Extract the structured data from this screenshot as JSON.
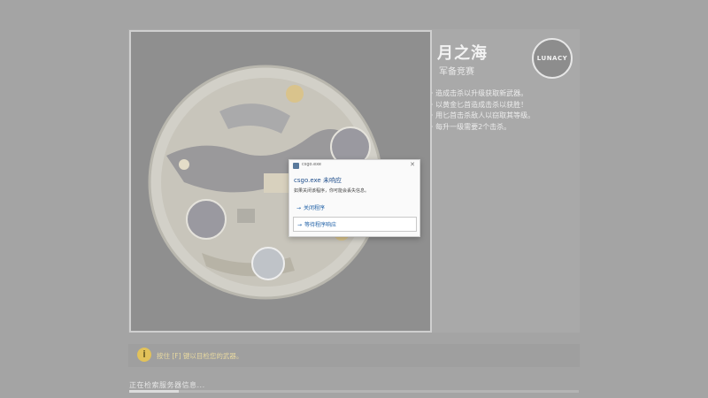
{
  "map": {
    "title": "月之海",
    "subtitle": "军备竞赛",
    "logo_text": "LUNACY"
  },
  "rules": [
    "造成击杀以升级获取新武器。",
    "以黄金匕首造成击杀以获胜！",
    "用匕首击杀敌人以窃取其等级。",
    "每升一级需要2个击杀。"
  ],
  "hint": {
    "icon": "i",
    "text": "按住 [F] 键以目检您的武器。"
  },
  "status": {
    "text": "正在检索服务器信息...",
    "progress": 0.11
  },
  "dialog": {
    "app_name": "csgo.exe",
    "close_glyph": "✕",
    "heading": "csgo.exe 未响应",
    "body": "如果关闭该程序，你可能会丢失信息。",
    "options": [
      "关闭程序",
      "等待程序响应"
    ],
    "arrow_glyph": "→"
  },
  "colors": {
    "background": "#a4a4a4",
    "dialog_link": "#1d5fa6",
    "hint_icon": "#e2c25a"
  }
}
